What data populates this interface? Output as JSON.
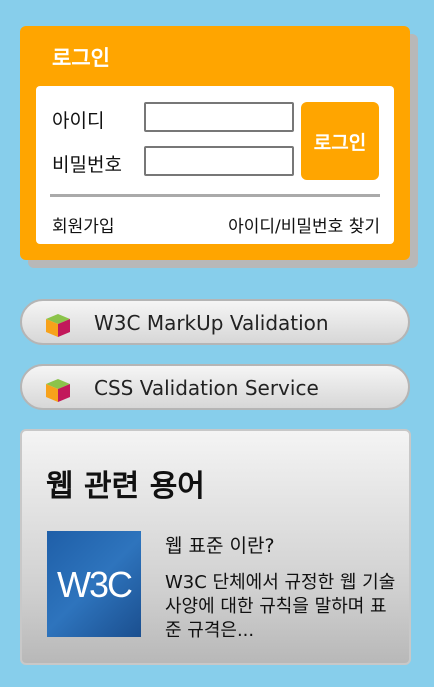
{
  "login": {
    "title": "로그인",
    "id_label": "아이디",
    "pw_label": "비밀번호",
    "id_value": "",
    "pw_value": "",
    "submit_label": "로그인",
    "join_link": "회원가입",
    "find_link": "아이디/비밀번호 찾기"
  },
  "validation_links": [
    {
      "label": "W3C MarkUp Validation",
      "icon": "cube-icon"
    },
    {
      "label": "CSS Validation Service",
      "icon": "cube-icon"
    }
  ],
  "terms": {
    "title": "웹 관련 용어",
    "article": {
      "image_text": "W3C",
      "title": "웹 표준 이란?",
      "summary": "W3C 단체에서 규정한 웹 기술 사양에 대한 규칙을 말하며 표준 규격은..."
    }
  },
  "colors": {
    "background": "#87ceeb",
    "accent": "#ffa500",
    "w3c_blue": "#2e74bd"
  }
}
